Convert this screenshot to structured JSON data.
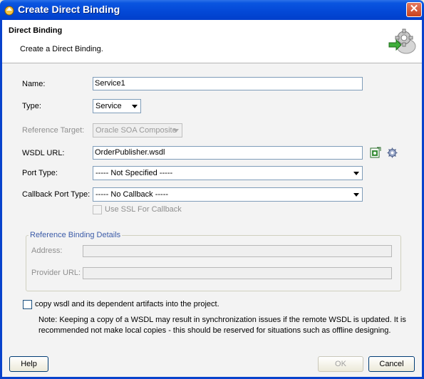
{
  "window": {
    "title": "Create Direct Binding"
  },
  "header": {
    "title": "Direct Binding",
    "description": "Create a Direct Binding."
  },
  "form": {
    "name": {
      "label": "Name:",
      "value": "Service1"
    },
    "type": {
      "label": "Type:",
      "value": "Service"
    },
    "reference_target": {
      "label": "Reference Target:",
      "value": "Oracle SOA Composite"
    },
    "wsdl_url": {
      "label": "WSDL URL:",
      "value": "OrderPublisher.wsdl"
    },
    "port_type": {
      "label": "Port Type:",
      "value": "----- Not Specified -----"
    },
    "callback_port_type": {
      "label": "Callback Port Type:",
      "value": "----- No Callback -----"
    },
    "use_ssl": {
      "label": "Use SSL For Callback"
    }
  },
  "reference_binding": {
    "title": "Reference Binding Details",
    "address_label": "Address:",
    "provider_url_label": "Provider URL:"
  },
  "copy_wsdl": {
    "label": "copy wsdl and its dependent artifacts into the project."
  },
  "note": "Note: Keeping a copy of a WSDL may result in synchronization issues if the remote WSDL is updated. It is recommended not make local copies - this should be reserved for situations such as offline designing.",
  "buttons": {
    "help": "Help",
    "ok": "OK",
    "cancel": "Cancel"
  }
}
